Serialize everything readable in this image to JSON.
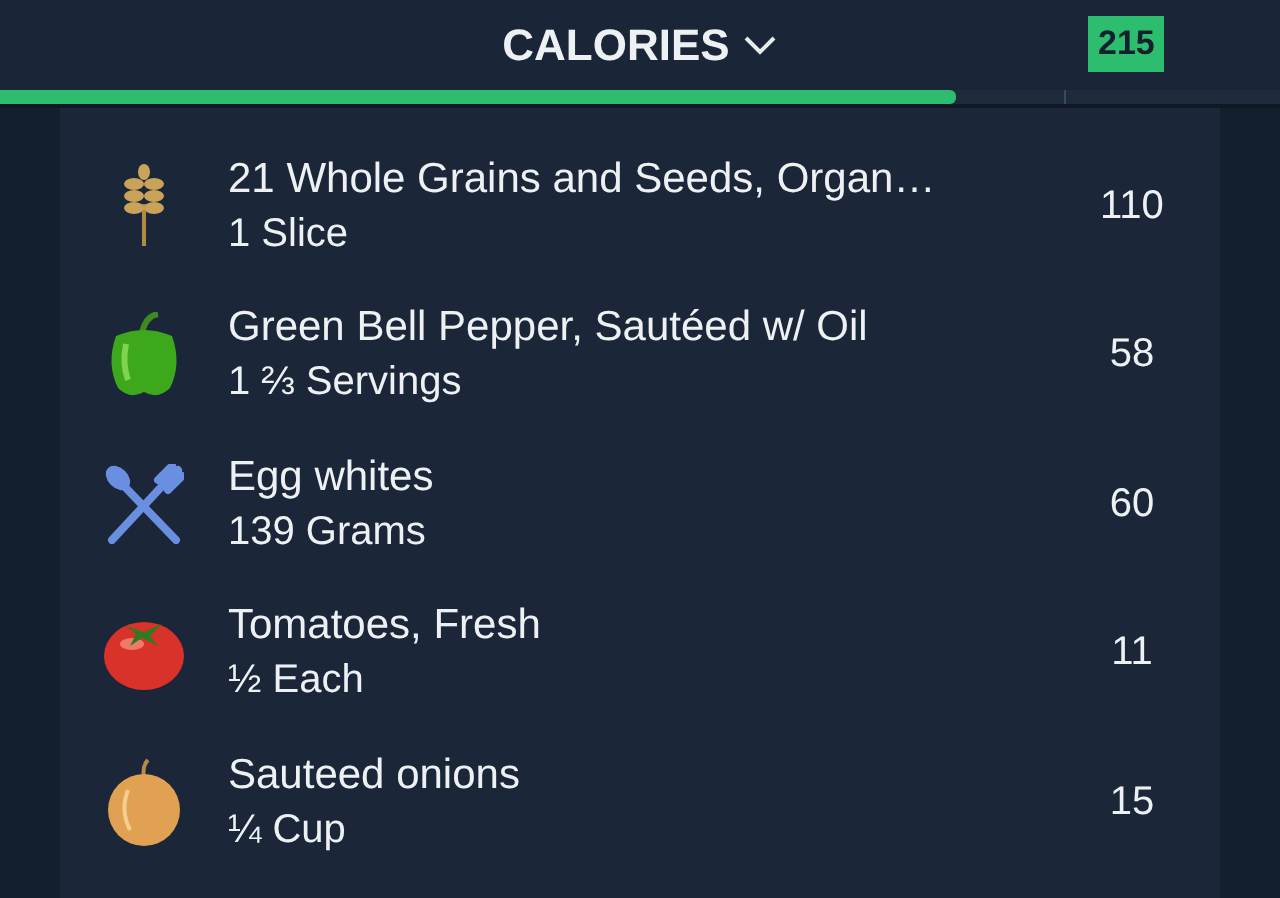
{
  "header": {
    "title": "CALORIES",
    "remaining": "215"
  },
  "progress": {
    "level": 0.747
  },
  "entries": [
    {
      "name": "21 Whole Grains and Seeds, Organ…",
      "amount": "1 Slice",
      "calories": "110"
    },
    {
      "name": "Green Bell Pepper, Sautéed w/ Oil",
      "amount": "1 ⅔ Servings",
      "calories": "58"
    },
    {
      "name": "Egg whites",
      "amount": "139 Grams",
      "calories": "60"
    },
    {
      "name": "Tomatoes, Fresh",
      "amount": "½ Each",
      "calories": "11"
    },
    {
      "name": "Sauteed onions",
      "amount": "¼ Cup",
      "calories": "15"
    }
  ]
}
